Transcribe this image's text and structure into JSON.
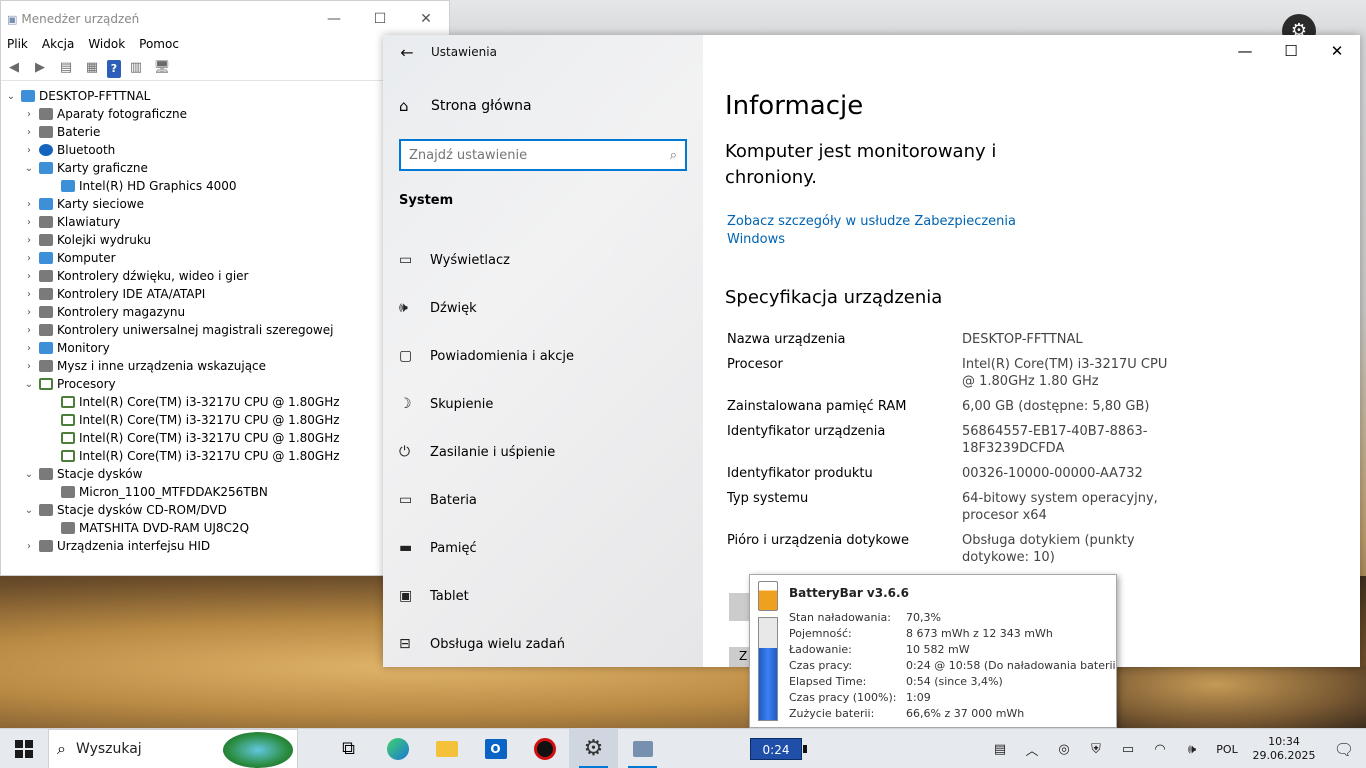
{
  "device_manager": {
    "title": "Menedżer urządzeń",
    "menu": [
      "Plik",
      "Akcja",
      "Widok",
      "Pomoc"
    ],
    "root": "DESKTOP-FFTTNAL",
    "tree": [
      {
        "label": "Aparaty fotograficzne",
        "level": 1,
        "state": "collapsed",
        "icon": "camera-icon"
      },
      {
        "label": "Baterie",
        "level": 1,
        "state": "collapsed",
        "icon": "battery-icon"
      },
      {
        "label": "Bluetooth",
        "level": 1,
        "state": "collapsed",
        "icon": "bluetooth-icon"
      },
      {
        "label": "Karty graficzne",
        "level": 1,
        "state": "expanded",
        "icon": "display-adapter-icon"
      },
      {
        "label": "Intel(R) HD Graphics 4000",
        "level": 2,
        "icon": "display-adapter-icon"
      },
      {
        "label": "Karty sieciowe",
        "level": 1,
        "state": "collapsed",
        "icon": "network-adapter-icon"
      },
      {
        "label": "Klawiatury",
        "level": 1,
        "state": "collapsed",
        "icon": "keyboard-icon"
      },
      {
        "label": "Kolejki wydruku",
        "level": 1,
        "state": "collapsed",
        "icon": "printer-icon"
      },
      {
        "label": "Komputer",
        "level": 1,
        "state": "collapsed",
        "icon": "computer-icon"
      },
      {
        "label": "Kontrolery dźwięku, wideo i gier",
        "level": 1,
        "state": "collapsed",
        "icon": "speaker-icon"
      },
      {
        "label": "Kontrolery IDE ATA/ATAPI",
        "level": 1,
        "state": "collapsed",
        "icon": "ide-controller-icon"
      },
      {
        "label": "Kontrolery magazynu",
        "level": 1,
        "state": "collapsed",
        "icon": "storage-controller-icon"
      },
      {
        "label": "Kontrolery uniwersalnej magistrali szeregowej",
        "level": 1,
        "state": "collapsed",
        "icon": "usb-icon"
      },
      {
        "label": "Monitory",
        "level": 1,
        "state": "collapsed",
        "icon": "monitor-icon"
      },
      {
        "label": "Mysz i inne urządzenia wskazujące",
        "level": 1,
        "state": "collapsed",
        "icon": "mouse-icon"
      },
      {
        "label": "Procesory",
        "level": 1,
        "state": "expanded",
        "icon": "cpu-icon"
      },
      {
        "label": "Intel(R) Core(TM) i3-3217U CPU @ 1.80GHz",
        "level": 2,
        "icon": "cpu-icon"
      },
      {
        "label": "Intel(R) Core(TM) i3-3217U CPU @ 1.80GHz",
        "level": 2,
        "icon": "cpu-icon"
      },
      {
        "label": "Intel(R) Core(TM) i3-3217U CPU @ 1.80GHz",
        "level": 2,
        "icon": "cpu-icon"
      },
      {
        "label": "Intel(R) Core(TM) i3-3217U CPU @ 1.80GHz",
        "level": 2,
        "icon": "cpu-icon"
      },
      {
        "label": "Stacje dysków",
        "level": 1,
        "state": "expanded",
        "icon": "disk-drive-icon"
      },
      {
        "label": "Micron_1100_MTFDDAK256TBN",
        "level": 2,
        "icon": "disk-drive-icon"
      },
      {
        "label": "Stacje dysków CD-ROM/DVD",
        "level": 1,
        "state": "expanded",
        "icon": "dvd-drive-icon"
      },
      {
        "label": "MATSHITA DVD-RAM UJ8C2Q",
        "level": 2,
        "icon": "dvd-drive-icon"
      },
      {
        "label": "Urządzenia interfejsu HID",
        "level": 1,
        "state": "collapsed",
        "icon": "hid-icon"
      }
    ]
  },
  "settings": {
    "window_title": "Ustawienia",
    "home": "Strona główna",
    "search_placeholder": "Znajdź ustawienie",
    "section": "System",
    "nav": [
      {
        "label": "Wyświetlacz",
        "icon": "display-icon"
      },
      {
        "label": "Dźwięk",
        "icon": "sound-icon"
      },
      {
        "label": "Powiadomienia i akcje",
        "icon": "notifications-icon"
      },
      {
        "label": "Skupienie",
        "icon": "moon-icon"
      },
      {
        "label": "Zasilanie i uśpienie",
        "icon": "power-icon"
      },
      {
        "label": "Bateria",
        "icon": "battery-icon"
      },
      {
        "label": "Pamięć",
        "icon": "storage-icon"
      },
      {
        "label": "Tablet",
        "icon": "tablet-icon"
      },
      {
        "label": "Obsługa wielu zadań",
        "icon": "multitasking-icon"
      }
    ],
    "heading": "Informacje",
    "protection": "Komputer jest monitorowany i chroniony.",
    "security_link": "Zobacz szczegóły w usłudze Zabezpieczenia Windows",
    "spec_heading": "Specyfikacja urządzenia",
    "specs": [
      {
        "k": "Nazwa urządzenia",
        "v": "DESKTOP-FFTTNAL"
      },
      {
        "k": "Procesor",
        "v": "Intel(R) Core(TM) i3-3217U CPU @ 1.80GHz   1.80 GHz"
      },
      {
        "k": "Zainstalowana pamięć RAM",
        "v": "6,00 GB (dostępne: 5,80 GB)"
      },
      {
        "k": "Identyfikator urządzenia",
        "v": "56864557-EB17-40B7-8863-18F3239DCFDA"
      },
      {
        "k": "Identyfikator produktu",
        "v": "00326-10000-00000-AA732"
      },
      {
        "k": "Typ systemu",
        "v": "64-bitowy system operacyjny, procesor x64"
      },
      {
        "k": "Pióro i urządzenia dotykowe",
        "v": "Obsługa dotykiem (punkty dotykowe: 10)"
      }
    ],
    "partial_button": "Z"
  },
  "batterybar": {
    "title": "BatteryBar v3.6.6",
    "level_percent": 70.3,
    "rows": [
      {
        "k": "Stan naładowania:",
        "v": "70,3%"
      },
      {
        "k": "Pojemność:",
        "v": "8 673 mWh z 12 343 mWh"
      },
      {
        "k": "Ładowanie:",
        "v": "10 582 mW"
      },
      {
        "k": "Czas pracy:",
        "v": "0:24 @ 10:58 (Do naładowania baterii"
      },
      {
        "k": "Elapsed Time:",
        "v": "0:54 (since 3,4%)"
      },
      {
        "k": "Czas pracy (100%):",
        "v": "1:09"
      },
      {
        "k": "Zużycie baterii:",
        "v": "66,6% z 37 000 mWh"
      }
    ]
  },
  "taskbar": {
    "search": "Wyszukaj",
    "battery_time": "0:24",
    "lang": "POL",
    "time": "10:34",
    "date": "29.06.2025"
  }
}
